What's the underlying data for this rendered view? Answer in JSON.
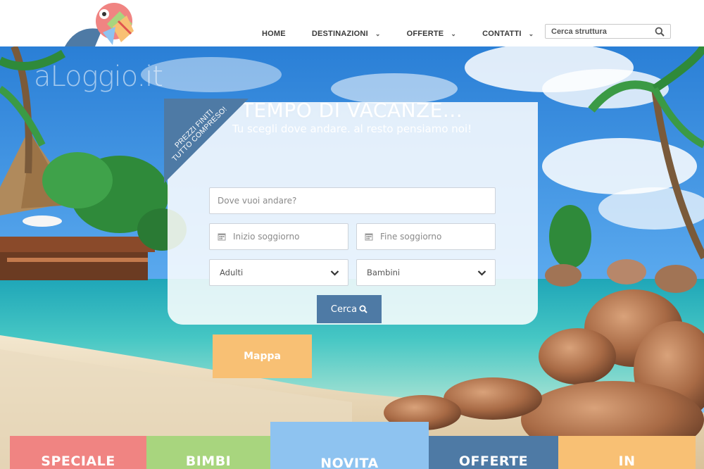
{
  "header": {
    "nav": [
      {
        "label": "HOME",
        "has_dropdown": false
      },
      {
        "label": "DESTINAZIONI",
        "has_dropdown": true
      },
      {
        "label": "OFFERTE",
        "has_dropdown": true
      },
      {
        "label": "CONTATTI",
        "has_dropdown": true
      }
    ],
    "search": {
      "placeholder": "Cerca struttura",
      "icon": "search-icon"
    }
  },
  "hero": {
    "watermark": "aLoggio.it",
    "title": "TEMPO DI VACANZE...",
    "subtitle": "Tu scegli dove andare. al resto pensiamo noi!"
  },
  "booking": {
    "ribbon": "PREZZI FINITI TUTTO COMPRESO!",
    "destination_placeholder": "Dove vuoi andare?",
    "checkin_placeholder": "Inizio soggiorno",
    "checkout_placeholder": "Fine soggiorno",
    "adults_value": "Adulti",
    "children_value": "Bambini",
    "search_button": "Cerca",
    "map_button": "Mappa"
  },
  "categories": [
    {
      "label": "SPECIALE",
      "color": "#f08482"
    },
    {
      "label": "BIMBI",
      "color": "#a8d57e"
    },
    {
      "label": "NOVITA",
      "color": "#8ec3f0"
    },
    {
      "label": "OFFERTE",
      "color": "#4e7aa5"
    },
    {
      "label": "IN",
      "color": "#f8c074"
    }
  ],
  "colors": {
    "accent_blue": "#4e7aa5",
    "accent_orange": "#f8c074"
  }
}
